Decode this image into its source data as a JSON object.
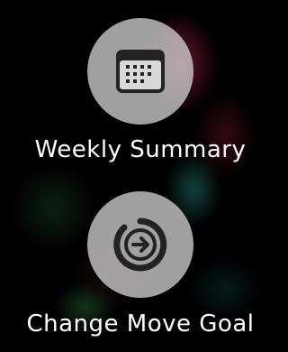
{
  "actions": [
    {
      "label": "Weekly Summary",
      "icon": "calendar-icon"
    },
    {
      "label": "Change Move Goal",
      "icon": "arrow-circle-icon"
    }
  ],
  "colors": {
    "background": "#000000",
    "button_fill": "#cdcdcd",
    "icon_dark": "#222222",
    "text": "#ffffff"
  }
}
